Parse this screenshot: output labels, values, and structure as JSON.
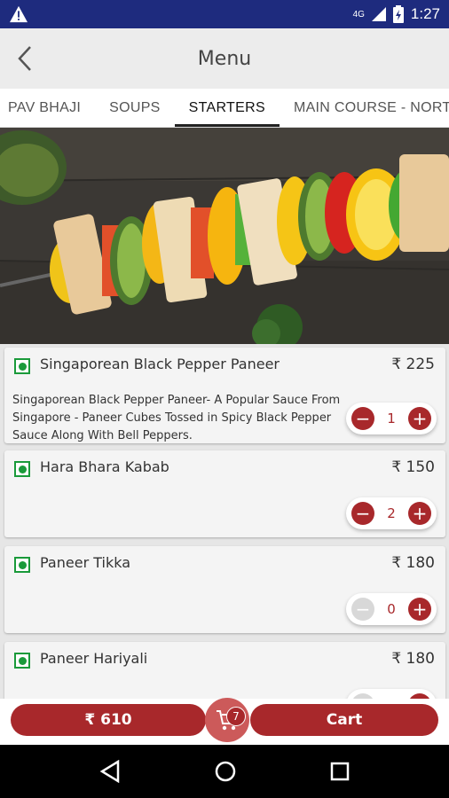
{
  "status_bar": {
    "time": "1:27",
    "network": "4G",
    "battery_icon": "battery-icon",
    "warning_icon": "warning-icon"
  },
  "app_bar": {
    "title": "Menu",
    "back_icon": "back-icon"
  },
  "tabs": [
    {
      "label": "PAV BHAJI",
      "active": false
    },
    {
      "label": "SOUPS",
      "active": false
    },
    {
      "label": "STARTERS",
      "active": true
    },
    {
      "label": "MAIN COURSE - NORTH",
      "active": false
    }
  ],
  "hero": {
    "image": "paneer-skewer-photo"
  },
  "items": [
    {
      "name": "Singaporean Black Pepper Paneer",
      "price": "₹ 225",
      "description": "Singaporean Black Pepper Paneer- A Popular Sauce From Singapore - Paneer Cubes Tossed in Spicy Black Pepper Sauce Along With Bell Peppers.",
      "qty": "1",
      "veg": true
    },
    {
      "name": "Hara Bhara Kabab",
      "price": "₹ 150",
      "description": "",
      "qty": "2",
      "veg": true
    },
    {
      "name": "Paneer Tikka",
      "price": "₹ 180",
      "description": "",
      "qty": "0",
      "veg": true
    },
    {
      "name": "Paneer Hariyali",
      "price": "₹ 180",
      "description": "",
      "qty": "",
      "veg": true
    }
  ],
  "bottom_bar": {
    "total": "₹ 610",
    "cart_label": "Cart",
    "cart_count": "7",
    "cart_icon": "cart-icon"
  },
  "colors": {
    "status_bar": "#1e2b7e",
    "accent": "#a8282b",
    "veg_green": "#1a9a3a"
  },
  "nav_bar": {
    "back": "nav-back-icon",
    "home": "nav-home-icon",
    "recents": "nav-recents-icon"
  }
}
